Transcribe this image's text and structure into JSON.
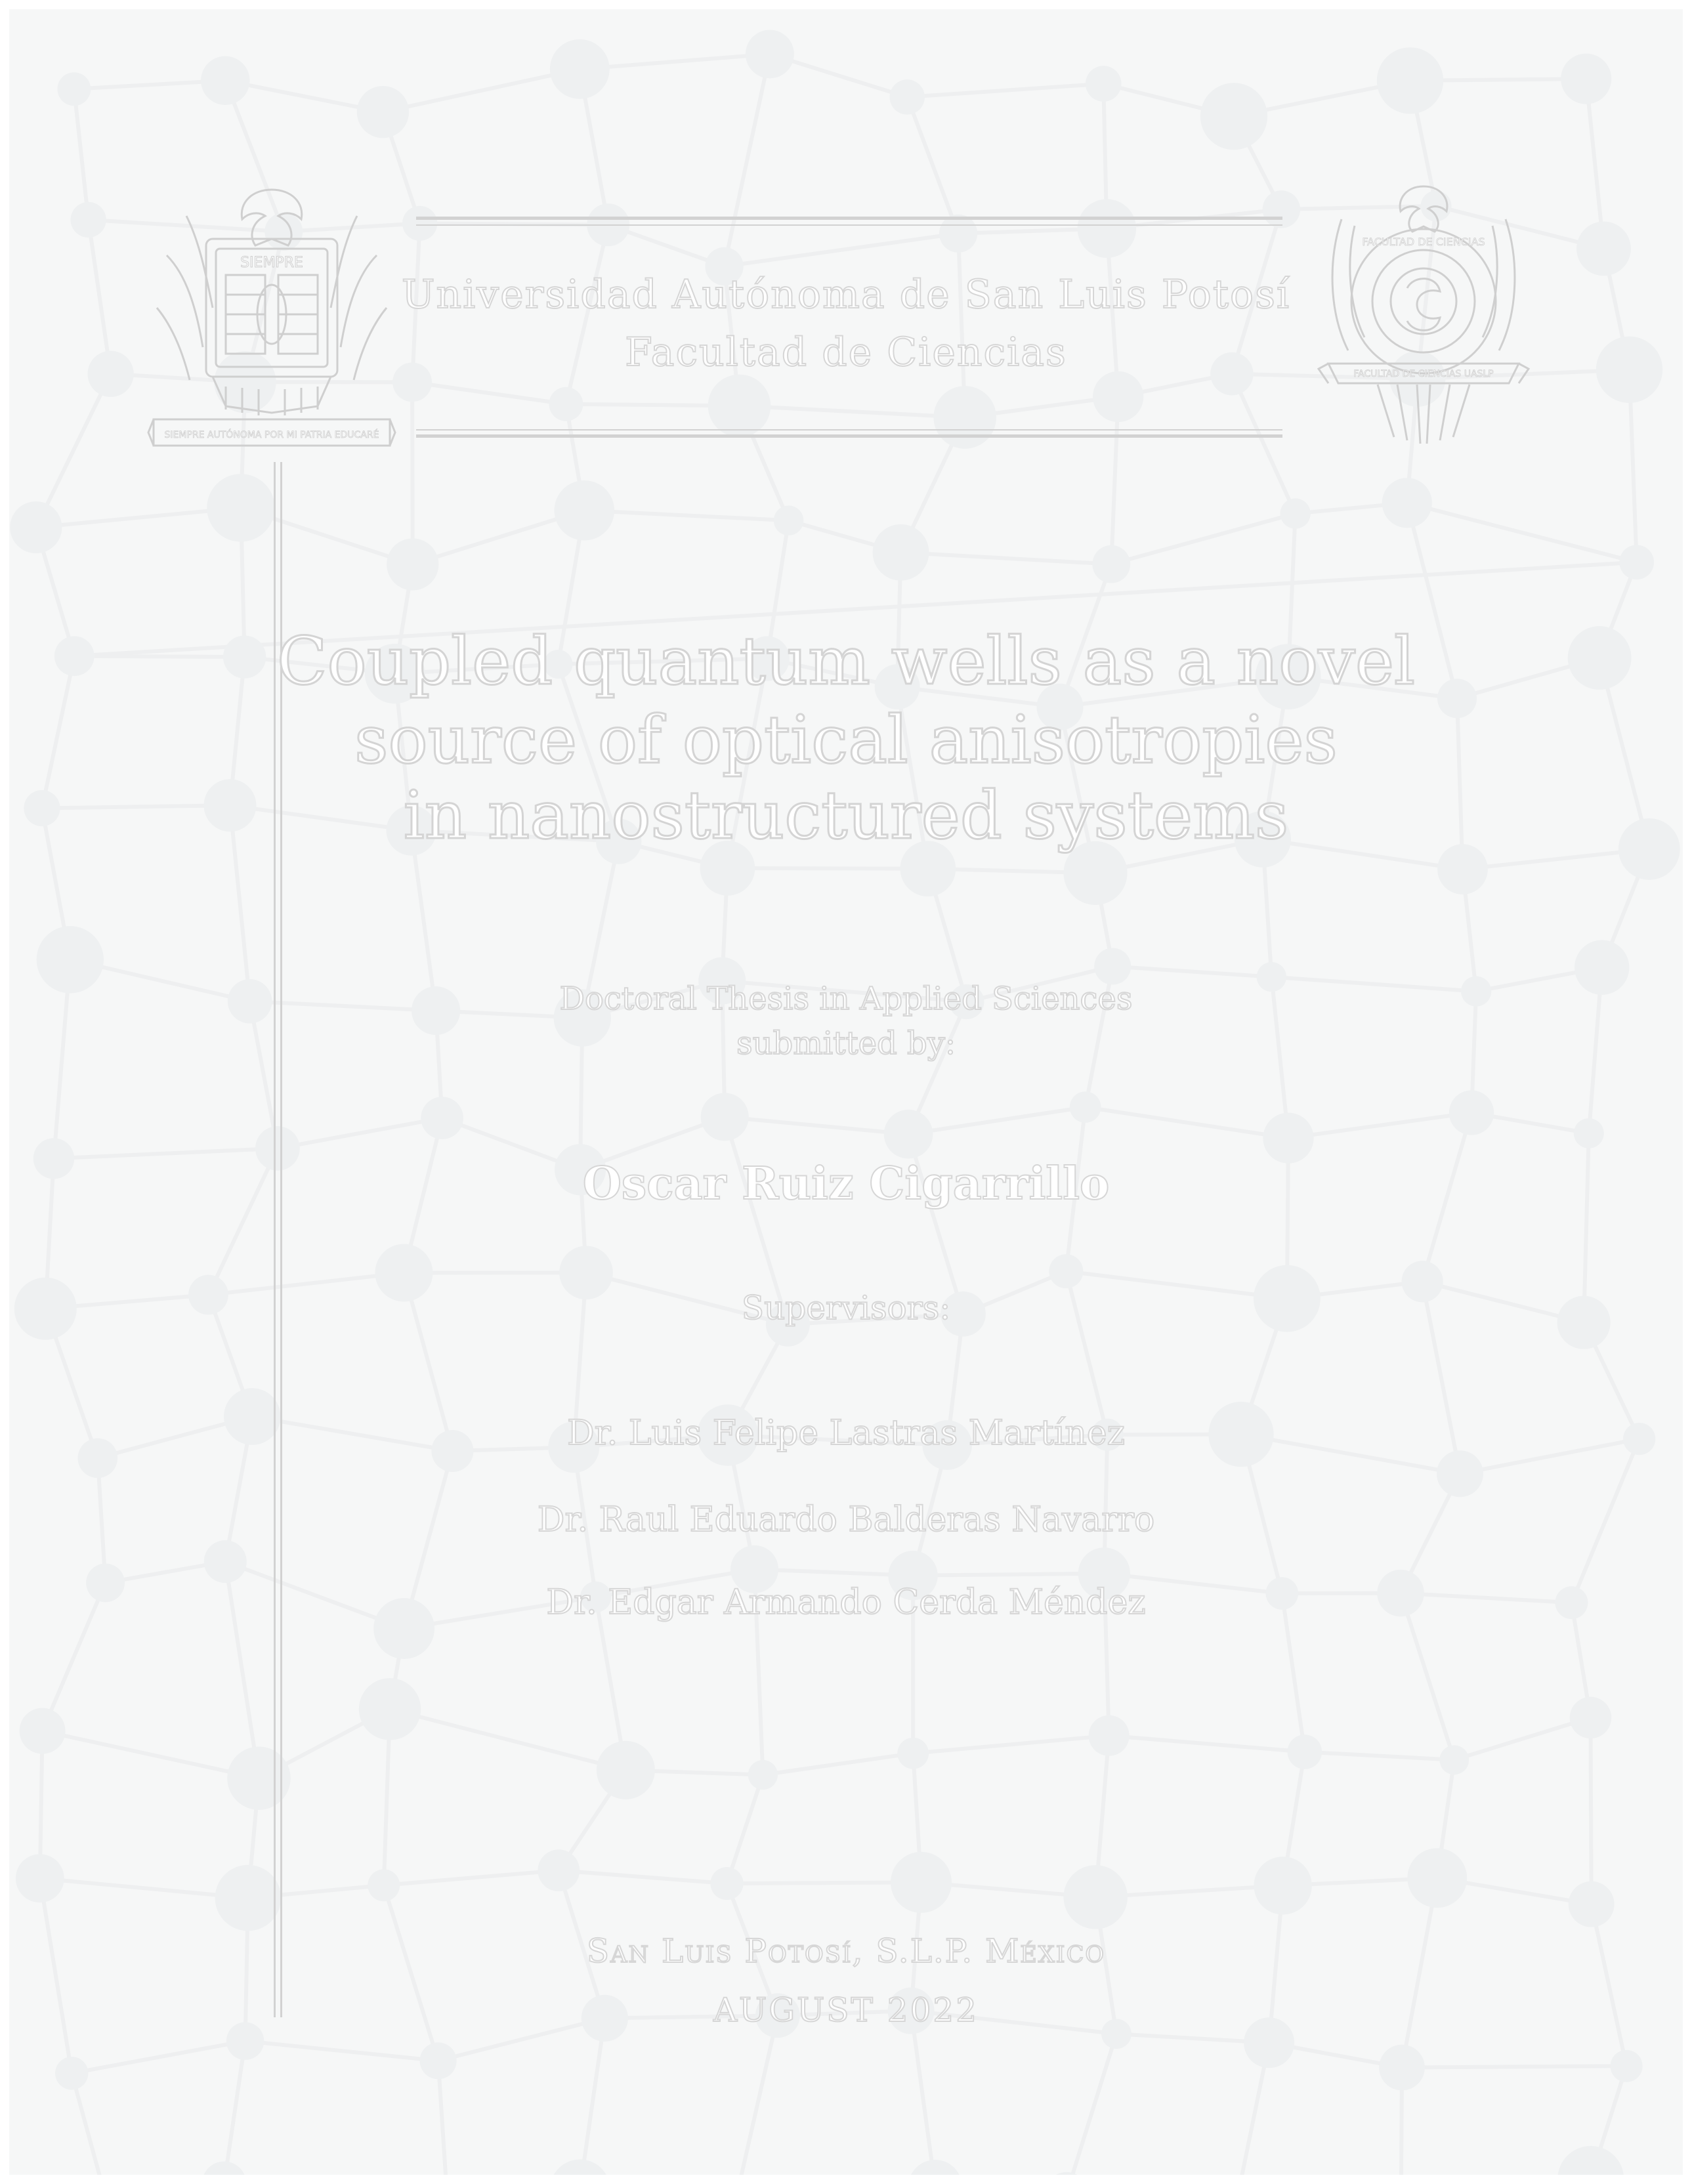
{
  "header": {
    "university": "Universidad Autónoma de San Luis Potosí",
    "faculty": "Facultad de Ciencias",
    "left_seal_ribbon": "SIEMPRE AUTÓNOMA POR MI PATRIA EDUCARÉ",
    "left_seal_banner": "SIEMPRE",
    "right_seal_ring": "FACULTAD DE CIENCIAS",
    "right_seal_ribbon": "FACULTAD DE CIENCIAS UASLP"
  },
  "title": {
    "line1": "Coupled quantum wells as a novel",
    "line2": "source of optical anisotropies",
    "line3": "in nanostructured systems"
  },
  "submission": {
    "line1": "Doctoral Thesis in Applied Sciences",
    "line2": "submitted by:"
  },
  "author": "Oscar Ruiz Cigarrillo",
  "supervisors": {
    "label": "Supervisors:",
    "names": [
      "Dr. Luis Felipe Lastras Martínez",
      "Dr. Raul Eduardo Balderas Navarro",
      "Dr. Edgar Armando Cerda Méndez"
    ]
  },
  "footer": {
    "place": "San Luis Potosí, S.L.P. México",
    "date": "AUGUST 2022"
  },
  "colors": {
    "page_background": "#f6f7f7",
    "outline_stroke": "#d6d6d6",
    "text_fill": "#ffffff"
  }
}
